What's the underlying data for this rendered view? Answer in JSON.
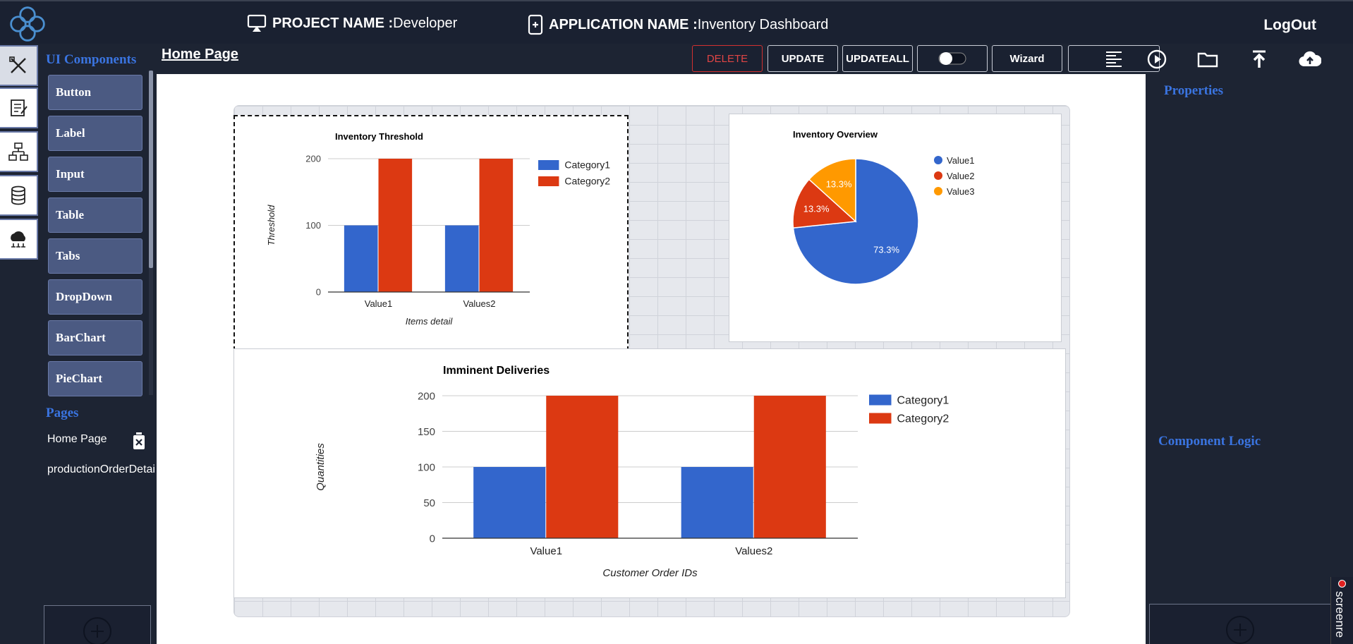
{
  "header": {
    "project_label": "PROJECT NAME :",
    "project_name": "Developer",
    "app_label": "APPLICATION NAME :",
    "app_name": "Inventory Dashboard",
    "logout": "LogOut"
  },
  "rail": {
    "icons": [
      "tools-icon",
      "form-icon",
      "flow-icon",
      "database-icon",
      "api-icon"
    ]
  },
  "components": {
    "title": "UI Components",
    "items": [
      "Button",
      "Label",
      "Input",
      "Table",
      "Tabs",
      "DropDown",
      "BarChart",
      "PieChart"
    ]
  },
  "pages": {
    "title": "Pages",
    "items": [
      "Home Page",
      "productionOrderDetai"
    ]
  },
  "page_title": "Home Page",
  "toolbar": {
    "delete": "DELETE",
    "update": "UPDATE",
    "updateall": "UPDATEALL",
    "wizard": "Wizard"
  },
  "right_panel": {
    "properties": "Properties",
    "component_logic": "Component Logic",
    "side_tab": "screenre"
  },
  "colors": {
    "category1": "#3366cc",
    "category2": "#dc3912",
    "value3": "#ff9900",
    "accent": "#3a74e0"
  },
  "chart_data": [
    {
      "type": "bar",
      "title": "Inventory Threshold",
      "xlabel": "Items detail",
      "ylabel": "Threshold",
      "categories": [
        "Value1",
        "Values2"
      ],
      "series": [
        {
          "name": "Category1",
          "values": [
            100,
            100
          ]
        },
        {
          "name": "Category2",
          "values": [
            200,
            200
          ]
        }
      ],
      "ylim": [
        0,
        200
      ],
      "yticks": [
        0,
        100,
        200
      ],
      "legend": "right"
    },
    {
      "type": "pie",
      "title": "Inventory Overview",
      "labels": [
        "Value1",
        "Value2",
        "Value3"
      ],
      "values": [
        73.3,
        13.3,
        13.3
      ],
      "slice_labels": [
        "73.3%",
        "13.3%",
        "13.3%"
      ],
      "legend": "right"
    },
    {
      "type": "bar",
      "title": "Imminent Deliveries",
      "xlabel": "Customer Order IDs",
      "ylabel": "Quantities",
      "categories": [
        "Value1",
        "Values2"
      ],
      "series": [
        {
          "name": "Category1",
          "values": [
            100,
            100
          ]
        },
        {
          "name": "Category2",
          "values": [
            200,
            200
          ]
        }
      ],
      "ylim": [
        0,
        200
      ],
      "yticks": [
        0,
        50,
        100,
        150,
        200
      ],
      "legend": "right"
    }
  ]
}
